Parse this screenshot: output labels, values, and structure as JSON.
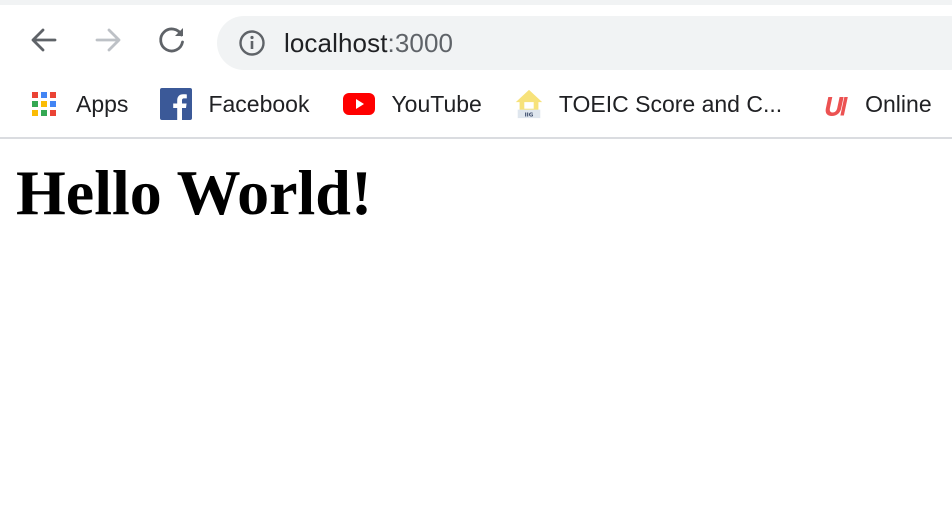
{
  "address_bar": {
    "host": "localhost",
    "port": ":3000"
  },
  "bookmarks": [
    {
      "label": "Apps",
      "icon": "apps-grid-icon"
    },
    {
      "label": "Facebook",
      "icon": "facebook-icon"
    },
    {
      "label": "YouTube",
      "icon": "youtube-icon"
    },
    {
      "label": "TOEIC Score and C...",
      "icon": "toeic-icon"
    },
    {
      "label": "Online",
      "icon": "udemy-icon"
    }
  ],
  "page": {
    "heading": "Hello World!"
  },
  "colors": {
    "facebook_blue": "#3b5998",
    "youtube_red": "#ff0000",
    "udemy_red": "#ec5252",
    "toolbar_icon": "#5f6368",
    "forward_disabled": "#bdc1c6"
  }
}
